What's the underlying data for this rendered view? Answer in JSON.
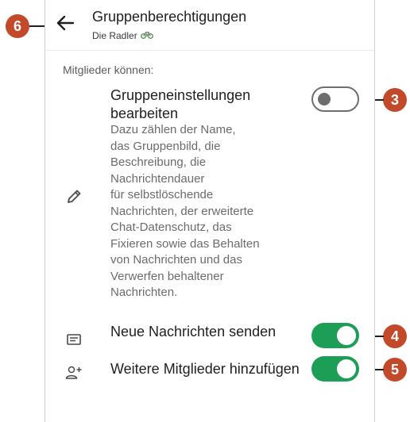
{
  "header": {
    "title": "Gruppenberechtigungen",
    "subtitle": "Die Radler",
    "back_icon": "arrow-left-icon",
    "subtitle_icon": "bicycle-icon"
  },
  "section_label": "Mitglieder können:",
  "settings": [
    {
      "title": "Gruppeneinstellungen bearbeiten",
      "description": "Dazu zählen der Name,\ndas Gruppenbild, die\nBeschreibung, die\nNachrichtendauer\nfür selbstlöschende\nNachrichten, der erweiterte\nChat-Datenschutz, das\nFixieren sowie das Behalten\nvon Nachrichten und das\nVerwerfen behaltener\nNachrichten.",
      "icon": "pencil-icon",
      "enabled": false
    },
    {
      "title": "Neue Nachrichten senden",
      "icon": "message-icon",
      "enabled": true
    },
    {
      "title": "Weitere Mitglieder hinzufügen",
      "icon": "add-person-icon",
      "enabled": true
    }
  ],
  "callouts": {
    "back": "6",
    "edit_toggle": "3",
    "send_toggle": "4",
    "add_toggle": "5"
  },
  "colors": {
    "toggle_on": "#1d9e57",
    "toggle_off": "#6e6e6e",
    "callout": "#c2492a"
  }
}
